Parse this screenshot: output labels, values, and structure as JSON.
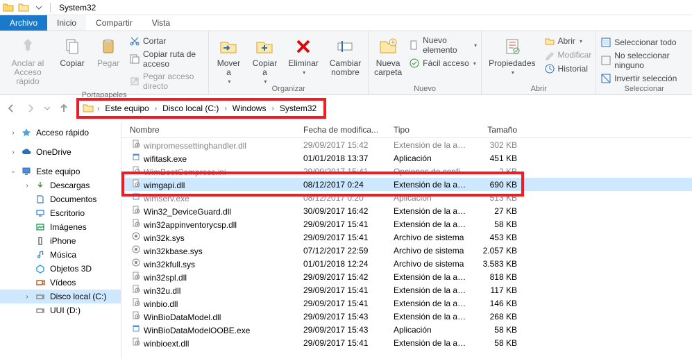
{
  "window": {
    "title": "System32"
  },
  "tabs": {
    "archivo": "Archivo",
    "inicio": "Inicio",
    "compartir": "Compartir",
    "vista": "Vista"
  },
  "ribbon": {
    "portapapeles": {
      "label": "Portapapeles",
      "anclar": "Anclar al\nAcceso rápido",
      "copiar": "Copiar",
      "pegar": "Pegar",
      "cortar": "Cortar",
      "copiar_ruta": "Copiar ruta de acceso",
      "pegar_directo": "Pegar acceso directo"
    },
    "organizar": {
      "label": "Organizar",
      "mover": "Mover\na",
      "copiar_a": "Copiar\na",
      "eliminar": "Eliminar",
      "cambiar": "Cambiar\nnombre"
    },
    "nuevo": {
      "label": "Nuevo",
      "nueva_carpeta": "Nueva\ncarpeta",
      "nuevo_elem": "Nuevo elemento",
      "facil": "Fácil acceso"
    },
    "abrir": {
      "label": "Abrir",
      "propiedades": "Propiedades",
      "abrir": "Abrir",
      "modificar": "Modificar",
      "historial": "Historial"
    },
    "seleccionar": {
      "label": "Seleccionar",
      "todo": "Seleccionar todo",
      "ninguno": "No seleccionar ninguno",
      "invertir": "Invertir selección"
    }
  },
  "breadcrumb": {
    "items": [
      "Este equipo",
      "Disco local (C:)",
      "Windows",
      "System32"
    ]
  },
  "sidebar": {
    "quick": "Acceso rápido",
    "onedrive": "OneDrive",
    "este": "Este equipo",
    "descargas": "Descargas",
    "documentos": "Documentos",
    "escritorio": "Escritorio",
    "imagenes": "Imágenes",
    "iphone": "iPhone",
    "musica": "Música",
    "objetos3d": "Objetos 3D",
    "videos": "Vídeos",
    "disco_c": "Disco local (C:)",
    "uui": "UUI (D:)"
  },
  "columns": {
    "nombre": "Nombre",
    "fecha": "Fecha de modifica...",
    "tipo": "Tipo",
    "tamano": "Tamaño"
  },
  "files": [
    {
      "name": "winpromessettinghandler.dll",
      "date": "29/09/2017 15:42",
      "type": "Extensión de la apl...",
      "size": "302 KB",
      "dim": true,
      "kind": "dll"
    },
    {
      "name": "wifitask.exe",
      "date": "01/01/2018 13:37",
      "type": "Aplicación",
      "size": "451 KB",
      "kind": "exe"
    },
    {
      "name": "WimBootCompress.ini",
      "date": "29/09/2017 15:41",
      "type": "Opciones de confi...",
      "size": "2 KB",
      "dim": true,
      "kind": "ini"
    },
    {
      "name": "wimgapi.dll",
      "date": "08/12/2017 0:24",
      "type": "Extensión de la apl...",
      "size": "690 KB",
      "sel": true,
      "kind": "dll"
    },
    {
      "name": "wimserv.exe",
      "date": "08/12/2017 0:20",
      "type": "Aplicación",
      "size": "513 KB",
      "dim": true,
      "kind": "exe"
    },
    {
      "name": "Win32_DeviceGuard.dll",
      "date": "30/09/2017 16:42",
      "type": "Extensión de la apl...",
      "size": "27 KB",
      "kind": "dll"
    },
    {
      "name": "win32appinventorycsp.dll",
      "date": "29/09/2017 15:41",
      "type": "Extensión de la apl...",
      "size": "58 KB",
      "kind": "dll"
    },
    {
      "name": "win32k.sys",
      "date": "29/09/2017 15:41",
      "type": "Archivo de sistema",
      "size": "453 KB",
      "kind": "sys"
    },
    {
      "name": "win32kbase.sys",
      "date": "07/12/2017 22:59",
      "type": "Archivo de sistema",
      "size": "2.057 KB",
      "kind": "sys"
    },
    {
      "name": "win32kfull.sys",
      "date": "01/01/2018 12:24",
      "type": "Archivo de sistema",
      "size": "3.583 KB",
      "kind": "sys"
    },
    {
      "name": "win32spl.dll",
      "date": "29/09/2017 15:42",
      "type": "Extensión de la apl...",
      "size": "818 KB",
      "kind": "dll"
    },
    {
      "name": "win32u.dll",
      "date": "29/09/2017 15:41",
      "type": "Extensión de la apl...",
      "size": "117 KB",
      "kind": "dll"
    },
    {
      "name": "winbio.dll",
      "date": "29/09/2017 15:41",
      "type": "Extensión de la apl...",
      "size": "146 KB",
      "kind": "dll"
    },
    {
      "name": "WinBioDataModel.dll",
      "date": "29/09/2017 15:43",
      "type": "Extensión de la apl...",
      "size": "268 KB",
      "kind": "dll"
    },
    {
      "name": "WinBioDataModelOOBE.exe",
      "date": "29/09/2017 15:43",
      "type": "Aplicación",
      "size": "58 KB",
      "kind": "exe"
    },
    {
      "name": "winbioext.dll",
      "date": "29/09/2017 15:41",
      "type": "Extensión de la apl...",
      "size": "58 KB",
      "kind": "dll"
    }
  ]
}
